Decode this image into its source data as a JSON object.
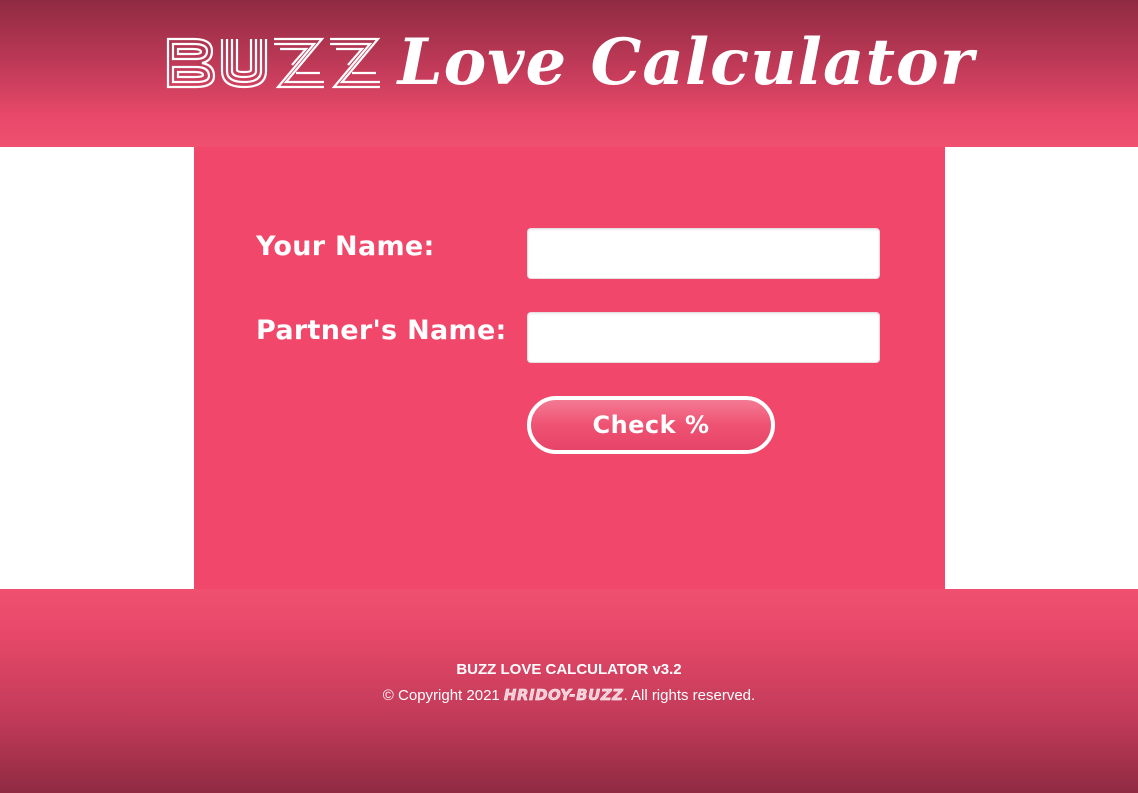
{
  "header": {
    "logo_text": "BUZZ",
    "title": "Love Calculator"
  },
  "form": {
    "your_name_label": "Your Name:",
    "your_name_value": "",
    "partner_name_label": "Partner's Name:",
    "partner_name_value": "",
    "check_button_label": "Check %"
  },
  "footer": {
    "app_name": "BUZZ LOVE CALCULATOR v3.2",
    "copyright_prefix": "© Copyright 2021 ",
    "author": "HRIDOY-BUZZ",
    "copyright_suffix": ". All rights reserved."
  },
  "colors": {
    "accent": "#f0476b",
    "header_dark": "#8f2a42",
    "text": "#ffffff"
  },
  "icons": {
    "logo": "buzz-logo-icon"
  }
}
